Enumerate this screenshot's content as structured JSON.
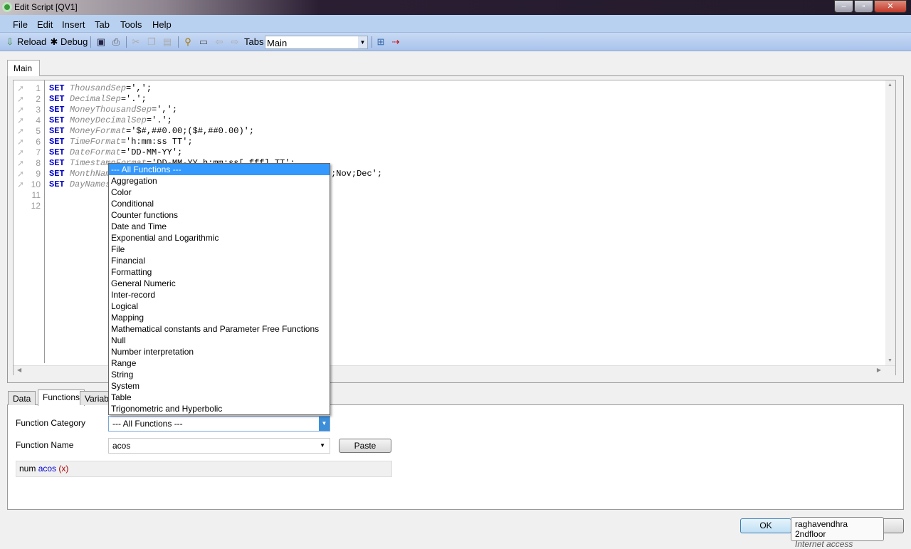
{
  "window": {
    "title": "Edit Script [QV1]"
  },
  "menu": [
    "File",
    "Edit",
    "Insert",
    "Tab",
    "Tools",
    "Help"
  ],
  "toolbar": {
    "reload": "Reload",
    "debug": "Debug",
    "tabs_label": "Tabs",
    "tabs_value": "Main"
  },
  "script_tab": "Main",
  "script_lines": [
    {
      "n": "1",
      "kw": "SET",
      "var": "ThousandSep",
      "rest": "=',';"
    },
    {
      "n": "2",
      "kw": "SET",
      "var": "DecimalSep",
      "rest": "='.';"
    },
    {
      "n": "3",
      "kw": "SET",
      "var": "MoneyThousandSep",
      "rest": "=',';"
    },
    {
      "n": "4",
      "kw": "SET",
      "var": "MoneyDecimalSep",
      "rest": "='.';"
    },
    {
      "n": "5",
      "kw": "SET",
      "var": "MoneyFormat",
      "rest": "='$#,##0.00;($#,##0.00)';"
    },
    {
      "n": "6",
      "kw": "SET",
      "var": "TimeFormat",
      "rest": "='h:mm:ss TT';"
    },
    {
      "n": "7",
      "kw": "SET",
      "var": "DateFormat",
      "rest": "='DD-MM-YY';"
    },
    {
      "n": "8",
      "kw": "SET",
      "var": "TimestampFormat",
      "rest": "='DD-MM-YY h:mm:ss[.fff] TT';"
    },
    {
      "n": "9",
      "kw": "SET",
      "var": "MonthNames",
      "rest": "='Jan;Feb;Mar;Apr;May;Jun;Jul;Aug;Sep;Oct;Nov;Dec';"
    },
    {
      "n": "10",
      "kw": "SET",
      "var": "DayNames",
      "rest": ""
    },
    {
      "n": "11",
      "kw": "",
      "var": "",
      "rest": ""
    },
    {
      "n": "12",
      "kw": "",
      "var": "",
      "rest": ""
    }
  ],
  "bottom_tabs": [
    "Data",
    "Functions",
    "Variables"
  ],
  "functions": {
    "category_label": "Function Category",
    "category_value": "--- All Functions ---",
    "name_label": "Function Name",
    "name_value": "acos",
    "paste": "Paste",
    "syntax": {
      "ret": "num",
      "fn": "acos",
      "args": "(x)"
    },
    "dropdown_options": [
      "--- All Functions ---",
      "Aggregation",
      "Color",
      "Conditional",
      "Counter functions",
      "Date and Time",
      "Exponential and Logarithmic",
      "File",
      "Financial",
      "Formatting",
      "General Numeric",
      "Inter-record",
      "Logical",
      "Mapping",
      "Mathematical constants and Parameter Free Functions",
      "Null",
      "Number interpretation",
      "Range",
      "String",
      "System",
      "Table",
      "Trigonometric and Hyperbolic"
    ]
  },
  "ok": "OK",
  "tooltip": {
    "title": "raghavendhra 2ndfloor",
    "subtitle": "Internet access"
  }
}
